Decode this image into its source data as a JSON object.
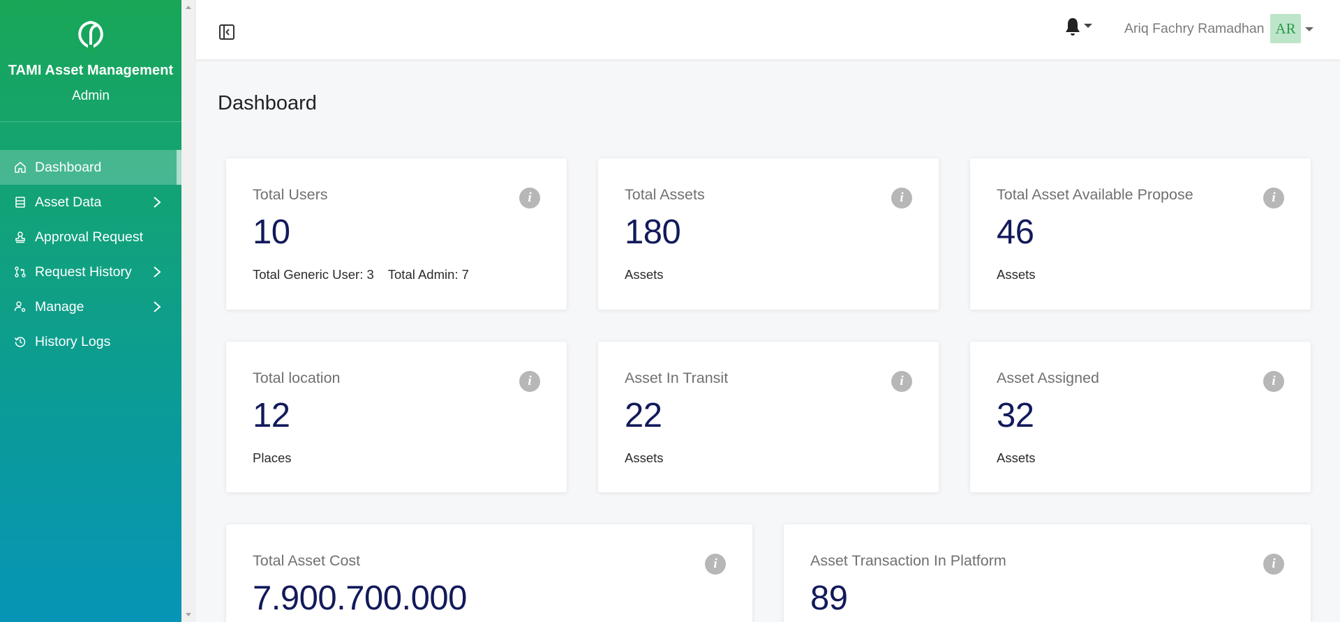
{
  "sidebar": {
    "brand_title": "TAMI Asset Management",
    "brand_subtitle": "Admin",
    "items": [
      {
        "label": "Dashboard",
        "icon": "home-icon",
        "active": true,
        "has_submenu": false
      },
      {
        "label": "Asset Data",
        "icon": "database-icon",
        "active": false,
        "has_submenu": true
      },
      {
        "label": "Approval Request",
        "icon": "stamp-icon",
        "active": false,
        "has_submenu": false
      },
      {
        "label": "Request History",
        "icon": "git-pull-icon",
        "active": false,
        "has_submenu": true
      },
      {
        "label": "Manage",
        "icon": "user-gear-icon",
        "active": false,
        "has_submenu": true
      },
      {
        "label": "History Logs",
        "icon": "history-icon",
        "active": false,
        "has_submenu": false
      }
    ]
  },
  "topbar": {
    "user_name": "Ariq Fachry Ramadhan",
    "avatar_initials": "AR"
  },
  "page": {
    "title": "Dashboard"
  },
  "cards": {
    "total_users": {
      "label": "Total Users",
      "value": "10",
      "sub_generic": "Total Generic User: 3",
      "sub_admin": "Total Admin: 7"
    },
    "total_assets": {
      "label": "Total Assets",
      "value": "180",
      "sub": "Assets"
    },
    "total_available": {
      "label": "Total Asset Available Propose",
      "value": "46",
      "sub": "Assets"
    },
    "total_location": {
      "label": "Total location",
      "value": "12",
      "sub": "Places"
    },
    "in_transit": {
      "label": "Asset In Transit",
      "value": "22",
      "sub": "Assets"
    },
    "assigned": {
      "label": "Asset Assigned",
      "value": "32",
      "sub": "Assets"
    },
    "total_cost": {
      "label": "Total Asset Cost",
      "value": "7.900.700.000"
    },
    "transactions": {
      "label": "Asset Transaction In Platform",
      "value": "89"
    }
  },
  "colors": {
    "sidebar_top": "#19a657",
    "sidebar_bottom": "#0695b6",
    "value_color": "#121a5a",
    "avatar_bg": "#bde5c9"
  }
}
